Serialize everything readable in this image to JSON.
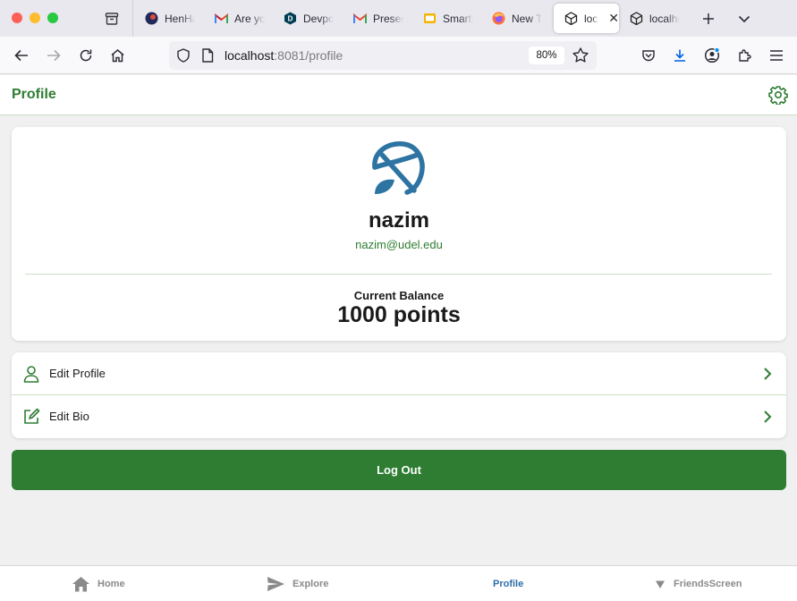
{
  "browser": {
    "tabs": [
      {
        "label": "HenHacks",
        "icon": "henhacks-favicon"
      },
      {
        "label": "Are you",
        "icon": "gmail-favicon"
      },
      {
        "label": "Devpost",
        "icon": "devpost-favicon"
      },
      {
        "label": "Presentation",
        "icon": "gmail-favicon"
      },
      {
        "label": "SmartBoard",
        "icon": "slides-favicon"
      },
      {
        "label": "New Tab",
        "icon": "firefox-favicon"
      },
      {
        "label": "localhost",
        "icon": "cube-favicon"
      },
      {
        "label": "localhost",
        "icon": "cube-favicon"
      }
    ],
    "url_host": "localhost",
    "url_rest": ":8081/profile",
    "zoom": "80%"
  },
  "app": {
    "title": "Profile",
    "user": {
      "name": "nazim",
      "email": "nazim@udel.edu"
    },
    "balance": {
      "label": "Current Balance",
      "value": "1000 points"
    },
    "menu": [
      {
        "label": "Edit Profile",
        "icon": "person-icon"
      },
      {
        "label": "Edit Bio",
        "icon": "edit-square-icon"
      }
    ],
    "logout_label": "Log Out",
    "bottom_nav": [
      {
        "label": "Home",
        "icon": "home-icon"
      },
      {
        "label": "Explore",
        "icon": "send-icon"
      },
      {
        "label": "Profile",
        "active": true
      },
      {
        "label": "FriendsScreen",
        "icon": "triangle-down-icon"
      }
    ]
  },
  "colors": {
    "accent": "#2e7d32",
    "nav_active": "#2c6ea8",
    "avatar": "#2e74a3"
  }
}
